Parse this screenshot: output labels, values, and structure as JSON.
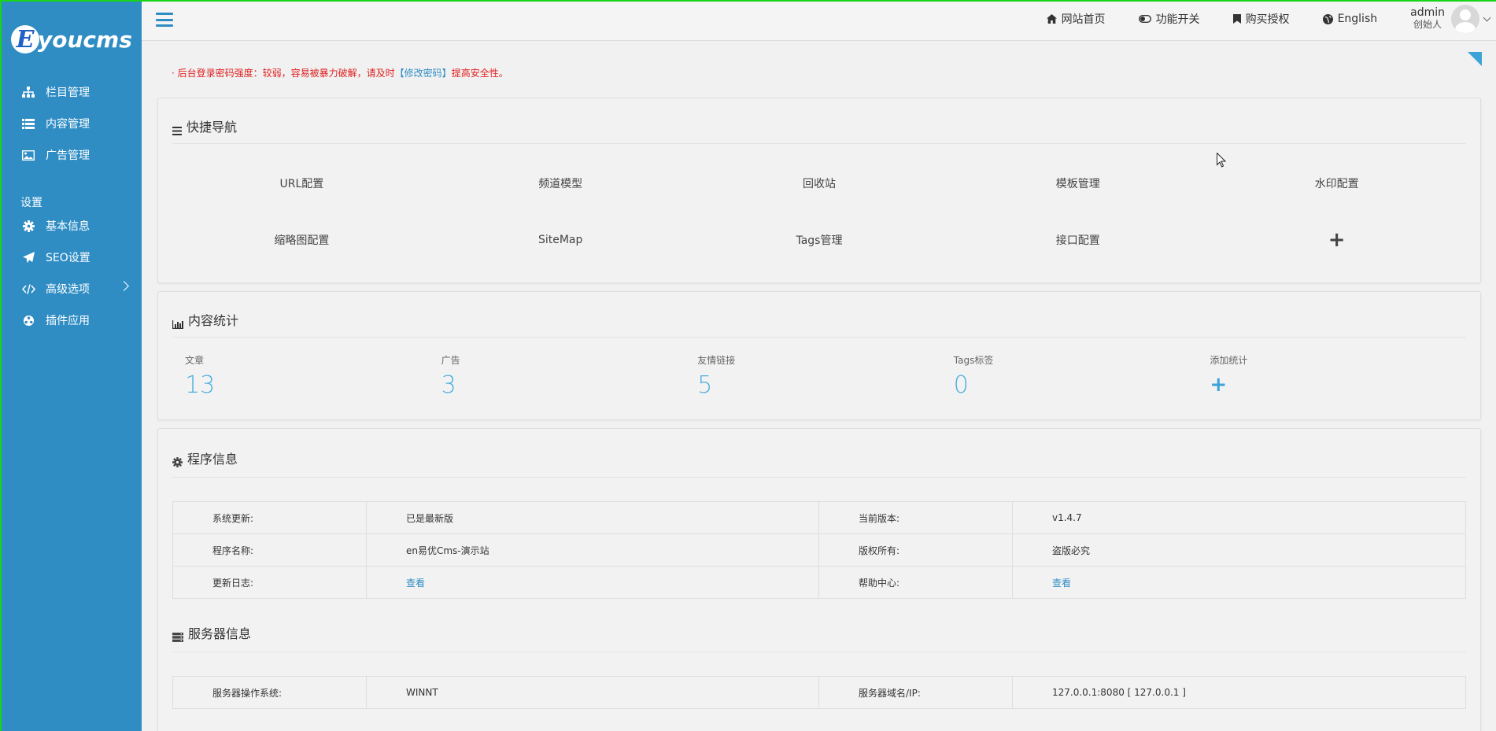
{
  "brand": {
    "logo_letter": "E",
    "logo_text": "youcms"
  },
  "sidebar": {
    "items": [
      {
        "label": "栏目管理",
        "icon": "sitemap-icon"
      },
      {
        "label": "内容管理",
        "icon": "list-icon"
      },
      {
        "label": "广告管理",
        "icon": "image-icon"
      }
    ],
    "section_label": "设置",
    "settings_items": [
      {
        "label": "基本信息",
        "icon": "gear-icon"
      },
      {
        "label": "SEO设置",
        "icon": "paper-plane-icon"
      },
      {
        "label": "高级选项",
        "icon": "code-icon"
      },
      {
        "label": "插件应用",
        "icon": "puzzle-icon"
      }
    ]
  },
  "topbar": {
    "links": [
      {
        "label": "网站首页",
        "icon": "home-icon"
      },
      {
        "label": "功能开关",
        "icon": "toggle-icon"
      },
      {
        "label": "购买授权",
        "icon": "bookmark-icon"
      },
      {
        "label": "English",
        "icon": "globe-icon"
      }
    ],
    "user_name": "admin",
    "user_role": "创始人"
  },
  "alert": {
    "bullet": "·",
    "text_before": "后台登录密码强度：较弱，容易被暴力破解，请及时",
    "link": "【修改密码】",
    "text_after": "提高安全性。"
  },
  "quick_nav": {
    "title": "快捷导航",
    "items": [
      "URL配置",
      "频道模型",
      "回收站",
      "模板管理",
      "水印配置",
      "缩略图配置",
      "SiteMap",
      "Tags管理",
      "接口配置"
    ],
    "add": "+"
  },
  "content_stats": {
    "title": "内容统计",
    "items": [
      {
        "label": "文章",
        "value": "13"
      },
      {
        "label": "广告",
        "value": "3"
      },
      {
        "label": "友情链接",
        "value": "5"
      },
      {
        "label": "Tags标签",
        "value": "0"
      }
    ],
    "add_label": "添加统计",
    "add": "+"
  },
  "program_info": {
    "title": "程序信息",
    "rows": [
      [
        "系统更新:",
        "已是最新版",
        "当前版本:",
        "v1.4.7"
      ],
      [
        "程序名称:",
        "en易优Cms-演示站",
        "版权所有:",
        "盗版必究"
      ],
      [
        "更新日志:",
        "查看",
        "帮助中心:",
        "查看"
      ]
    ]
  },
  "server_info": {
    "title": "服务器信息",
    "rows": [
      [
        "服务器操作系统:",
        "WINNT",
        "服务器域名/IP:",
        "127.0.0.1:8080 [ 127.0.0.1 ]"
      ]
    ]
  },
  "colors": {
    "sidebar": "#2f8dc4",
    "accent": "#4fb0e0",
    "alert": "#e02020"
  }
}
